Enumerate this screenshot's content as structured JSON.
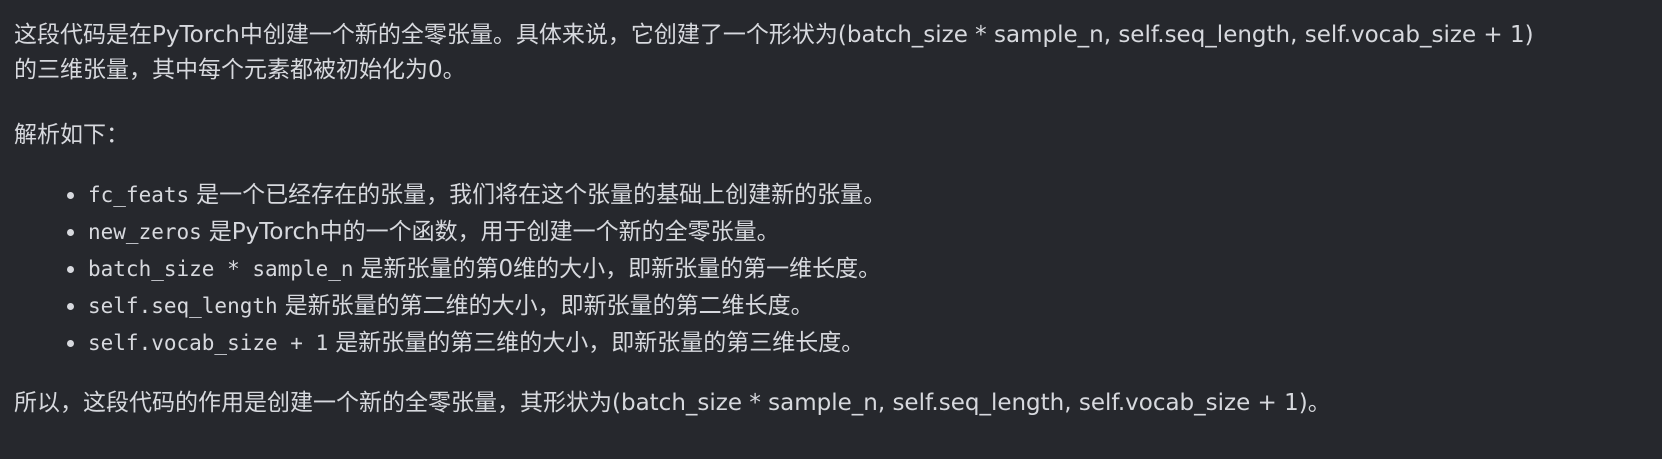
{
  "answer": {
    "intro_line1": "这段代码是在PyTorch中创建一个新的全零张量。具体来说，它创建了一个形状为(batch_size * sample_n, self.seq_length, self.vocab_size + 1)",
    "intro_line2": "的三维张量，其中每个元素都被初始化为0。",
    "analysis_heading": "解析如下：",
    "items": [
      {
        "code": "fc_feats",
        "text": "是一个已经存在的张量，我们将在这个张量的基础上创建新的张量。"
      },
      {
        "code": "new_zeros",
        "text": "是PyTorch中的一个函数，用于创建一个新的全零张量。"
      },
      {
        "code": "batch_size * sample_n",
        "text": "是新张量的第0维的大小，即新张量的第一维长度。"
      },
      {
        "code": "self.seq_length",
        "text": "是新张量的第二维的大小，即新张量的第二维长度。"
      },
      {
        "code": "self.vocab_size + 1",
        "text": "是新张量的第三维的大小，即新张量的第三维长度。"
      }
    ],
    "conclusion": "所以，这段代码的作用是创建一个新的全零张量，其形状为(batch_size * sample_n, self.seq_length, self.vocab_size + 1)。"
  }
}
